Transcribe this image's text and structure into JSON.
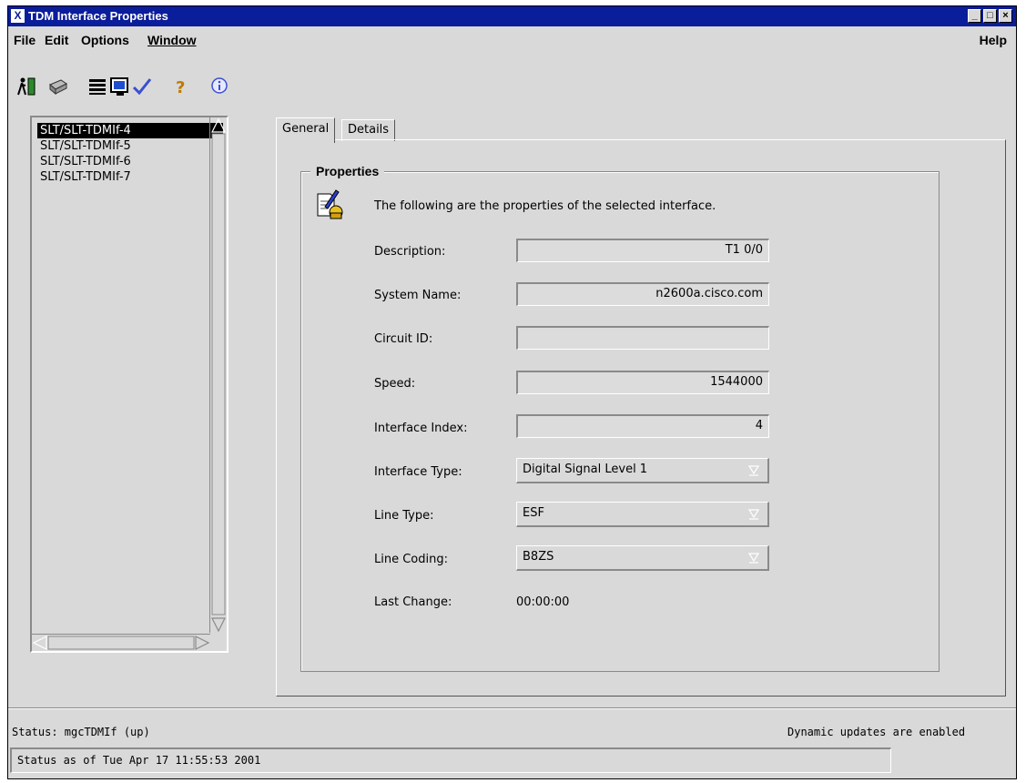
{
  "window": {
    "title": "TDM Interface Properties",
    "app_icon_glyph": "X",
    "minimize_glyph": "_",
    "maximize_glyph": "□",
    "close_glyph": "×"
  },
  "menu": {
    "file": "File",
    "edit": "Edit",
    "options": "Options",
    "window": "Window",
    "help": "Help"
  },
  "toolbar": {
    "icons": [
      "exit-icon",
      "print-icon",
      "list-icon",
      "monitor-icon",
      "checkmark-icon",
      "help-icon",
      "info-icon"
    ]
  },
  "list": {
    "items": [
      "SLT/SLT-TDMIf-4",
      "SLT/SLT-TDMIf-5",
      "SLT/SLT-TDMIf-6",
      "SLT/SLT-TDMIf-7"
    ],
    "selected_index": 0
  },
  "tabs": {
    "general": "General",
    "details": "Details"
  },
  "properties": {
    "group_label": "Properties",
    "intro": "The following are the properties of the selected interface.",
    "description_label": "Description:",
    "description_value": "T1 0/0",
    "system_name_label": "System Name:",
    "system_name_value": "n2600a.cisco.com",
    "circuit_id_label": "Circuit ID:",
    "circuit_id_value": "",
    "speed_label": "Speed:",
    "speed_value": "1544000",
    "interface_index_label": "Interface Index:",
    "interface_index_value": "4",
    "interface_type_label": "Interface Type:",
    "interface_type_value": "Digital Signal Level 1",
    "line_type_label": "Line Type:",
    "line_type_value": "ESF",
    "line_coding_label": "Line Coding:",
    "line_coding_value": "B8ZS",
    "last_change_label": "Last Change:",
    "last_change_value": "00:00:00"
  },
  "status": {
    "left": "Status: mgcTDMIf (up)",
    "right": "Dynamic updates are enabled",
    "box": "Status as of Tue Apr 17 11:55:53 2001"
  },
  "colors": {
    "titlebar": "#0a1d9a",
    "window_bg": "#d9d9d9",
    "selection": "#000000"
  }
}
